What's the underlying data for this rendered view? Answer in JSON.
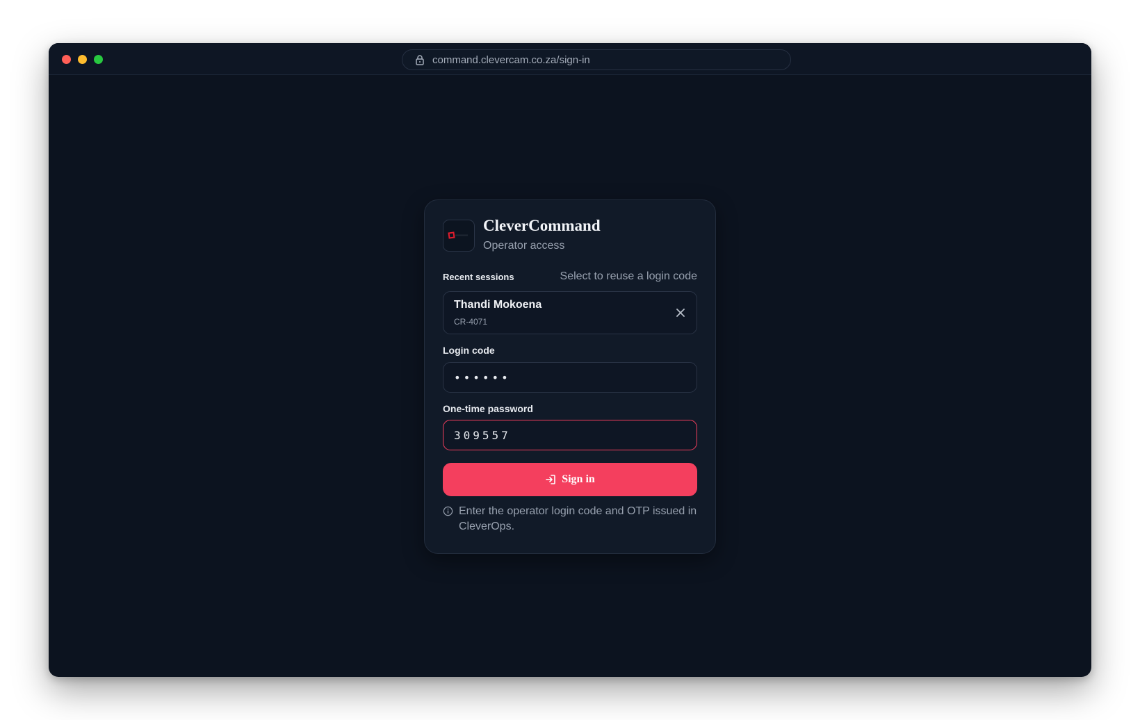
{
  "browser": {
    "url": "command.clevercam.co.za/sign-in",
    "icons": {
      "lock": "lock-icon"
    }
  },
  "app": {
    "brand": "CleverCommand",
    "subtitle": "Operator access",
    "logo": "clevercam-logo-icon",
    "accent_color": "#f43f5e"
  },
  "recent": {
    "label": "Recent sessions",
    "hint": "Select to reuse a login code",
    "sessions": [
      {
        "name": "Thandi Mokoena",
        "code": "CR-4071"
      }
    ]
  },
  "form": {
    "login_code": {
      "label": "Login code",
      "value": "••••••"
    },
    "otp": {
      "label": "One-time password",
      "value": "309557"
    },
    "submit_label": "Sign in",
    "help_text": "Enter the operator login code and OTP issued in CleverOps."
  }
}
